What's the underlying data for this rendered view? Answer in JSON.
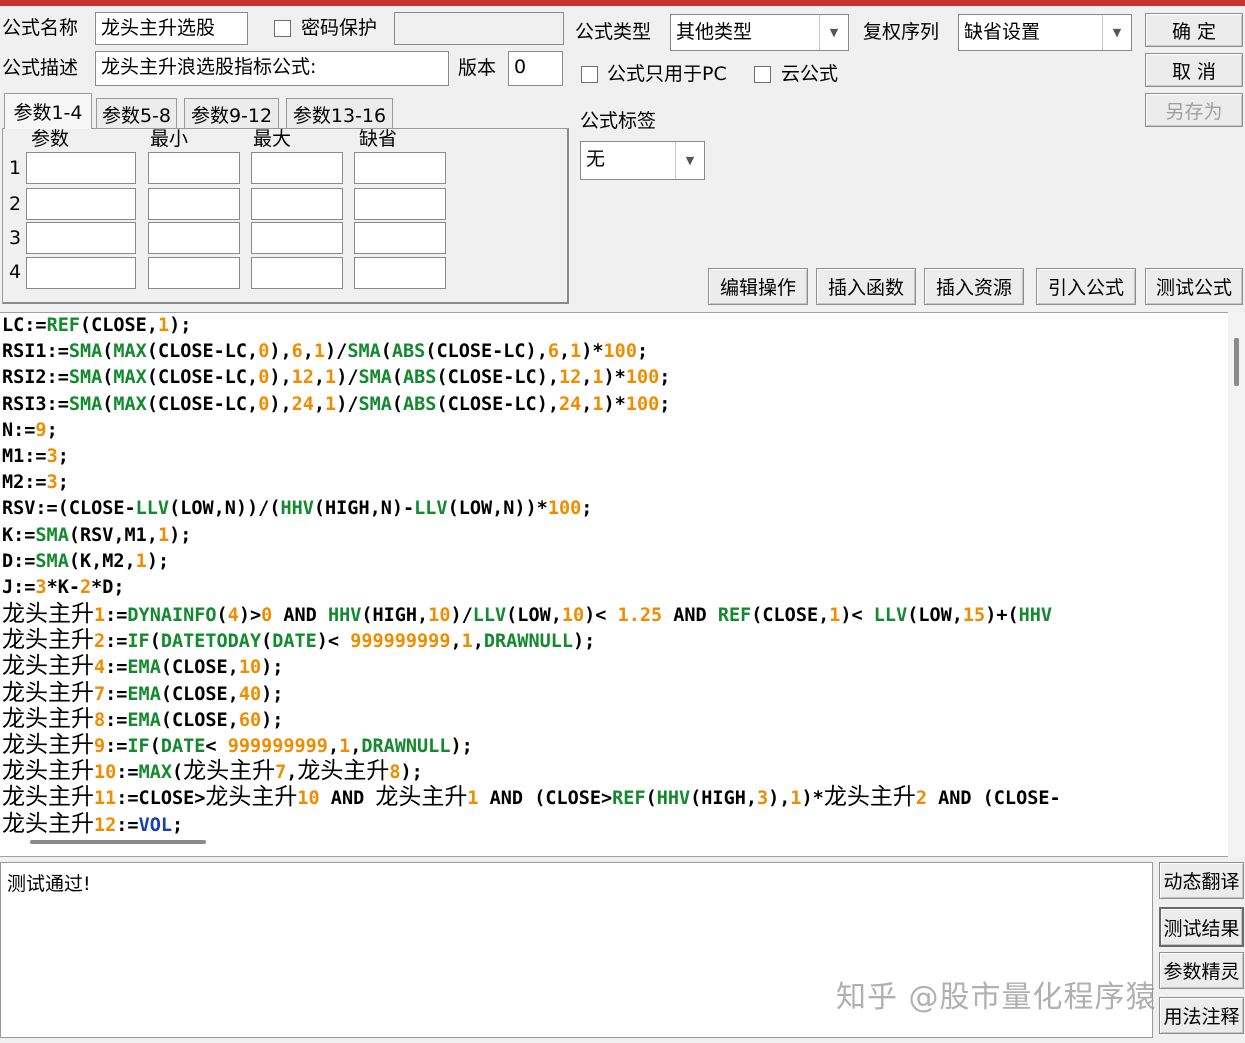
{
  "window": {
    "accent_color": "#c8322c"
  },
  "header": {
    "name_label": "公式名称",
    "name_value": "龙头主升选股",
    "password_label": "密码保护",
    "password_value": "",
    "desc_label": "公式描述",
    "desc_value": "龙头主升浪选股指标公式:",
    "version_label": "版本",
    "version_value": "0",
    "type_label": "公式类型",
    "type_value": "其他类型",
    "fuquan_label": "复权序列",
    "fuquan_value": "缺省设置",
    "pc_only_label": "公式只用于PC",
    "cloud_label": "云公式",
    "tag_label": "公式标签",
    "tag_value": "无"
  },
  "buttons": {
    "confirm": "确 定",
    "cancel": "取 消",
    "save_as": "另存为",
    "edit_ops": "编辑操作",
    "insert_func": "插入函数",
    "insert_res": "插入资源",
    "import_formula": "引入公式",
    "test_formula": "测试公式",
    "dynamic_translate": "动态翻译",
    "test_result": "测试结果",
    "param_wizard": "参数精灵",
    "usage_notes": "用法注释"
  },
  "params": {
    "tabs": [
      "参数1-4",
      "参数5-8",
      "参数9-12",
      "参数13-16"
    ],
    "headers": [
      "参数",
      "最小",
      "最大",
      "缺省"
    ],
    "rows": [
      "1",
      "2",
      "3",
      "4"
    ]
  },
  "code_lines": [
    "LC:=REF(CLOSE,1);",
    "RSI1:=SMA(MAX(CLOSE-LC,0),6,1)/SMA(ABS(CLOSE-LC),6,1)*100;",
    "RSI2:=SMA(MAX(CLOSE-LC,0),12,1)/SMA(ABS(CLOSE-LC),12,1)*100;",
    "RSI3:=SMA(MAX(CLOSE-LC,0),24,1)/SMA(ABS(CLOSE-LC),24,1)*100;",
    "N:=9;",
    "M1:=3;",
    "M2:=3;",
    "RSV:=(CLOSE-LLV(LOW,N))/(HHV(HIGH,N)-LLV(LOW,N))*100;",
    "K:=SMA(RSV,M1,1);",
    "D:=SMA(K,M2,1);",
    "J:=3*K-2*D;",
    "龙头主升1:=DYNAINFO(4)>0 AND HHV(HIGH,10)/LLV(LOW,10)< 1.25 AND REF(CLOSE,1)< LLV(LOW,15)+(HHV",
    "龙头主升2:=IF(DATETODAY(DATE)< 999999999,1,DRAWNULL);",
    "龙头主升4:=EMA(CLOSE,10);",
    "龙头主升7:=EMA(CLOSE,40);",
    "龙头主升8:=EMA(CLOSE,60);",
    "龙头主升9:=IF(DATE< 999999999,1,DRAWNULL);",
    "龙头主升10:=MAX(龙头主升7,龙头主升8);",
    "龙头主升11:=CLOSE>龙头主升10 AND 龙头主升1 AND (CLOSE>REF(HHV(HIGH,3),1)*龙头主升2 AND (CLOSE-",
    "龙头主升12:=VOL;"
  ],
  "output": {
    "text": "测试通过!"
  },
  "watermark": "知乎 @股市量化程序猿"
}
